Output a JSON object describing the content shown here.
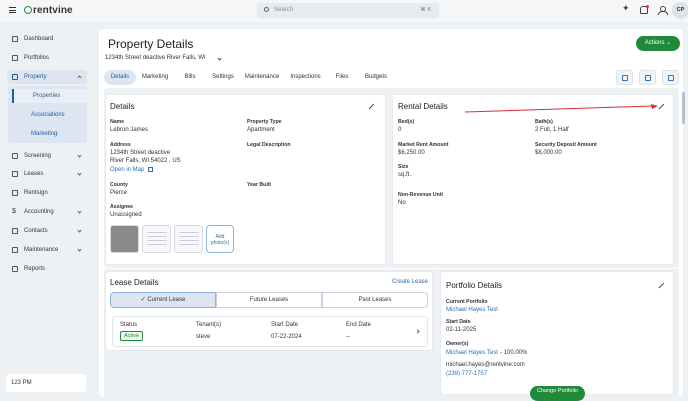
{
  "topbar": {
    "logo": "rentvine",
    "search_placeholder": "Search",
    "search_shortcut": "⌘ K",
    "avatar": "CP",
    "icons": [
      "menu-icon",
      "sparkle-icon",
      "bell-icon",
      "person-icon"
    ]
  },
  "sidebar": {
    "items": [
      {
        "label": "Dashboard",
        "icon": "dashboard-icon"
      },
      {
        "label": "Portfolios",
        "icon": "portfolio-icon"
      },
      {
        "label": "Property",
        "icon": "property-icon"
      },
      {
        "label": "Screening",
        "icon": "screening-icon"
      },
      {
        "label": "Leases",
        "icon": "lease-icon"
      },
      {
        "label": "Rentsign",
        "icon": "rentsign-icon"
      },
      {
        "label": "Accounting",
        "icon": "dollar-icon"
      },
      {
        "label": "Contacts",
        "icon": "contacts-icon"
      },
      {
        "label": "Maintenance",
        "icon": "maintenance-icon"
      },
      {
        "label": "Reports",
        "icon": "reports-icon"
      }
    ],
    "subitems": [
      "Properties",
      "Associations",
      "Marketing"
    ],
    "clock": "123 PM"
  },
  "page": {
    "title": "Property Details",
    "address_select": "1234th Street deactive River Falls, WI",
    "actions_label": "Actions",
    "tabs": [
      "Details",
      "Marketing",
      "Bills",
      "Settings",
      "Maintenance",
      "Inspections",
      "Files",
      "Budgets"
    ]
  },
  "details": {
    "title": "Details",
    "name_label": "Name",
    "name": "Lebron James",
    "property_type_label": "Property Type",
    "property_type": "Apartment",
    "address_label": "Address",
    "address_line1": "1234th Street deactive",
    "address_line2": "River Falls, WI 54022 , US",
    "legal_label": "Legal Description",
    "open_map": "Open in Map",
    "county_label": "County",
    "county": "Pierce",
    "year_label": "Year Built",
    "assignee_label": "Assignee",
    "assignee": "Unassigned",
    "add_photo": "Add photo(s)"
  },
  "rental": {
    "title": "Rental Details",
    "beds_label": "Bed(s)",
    "beds": "0",
    "baths_label": "Bath(s)",
    "baths": "2 Full, 1 Half",
    "market_label": "Market Rent Amount",
    "market": "$6,250.00",
    "deposit_label": "Security Deposit Amount",
    "deposit": "$8,000.00",
    "size_label": "Size",
    "size": "sq.ft.",
    "nonrev_label": "Non-Revenue Unit",
    "nonrev": "No"
  },
  "lease": {
    "title": "Lease Details",
    "create": "Create Lease",
    "segments": [
      "Current Lease",
      "Future Leases",
      "Past Leases"
    ],
    "headers": [
      "Status",
      "Tenant(s)",
      "Start Date",
      "End Date"
    ],
    "row": {
      "status": "Active",
      "tenant": "steve",
      "start": "07-22-2024",
      "end": "--"
    }
  },
  "portfolio": {
    "title": "Portfolio Details",
    "current_label": "Current Portfolio",
    "current": "Michael Hayes Test",
    "start_label": "Start Date",
    "start": "02-11-2025",
    "owners_label": "Owner(s)",
    "owner": "Michael Hayes Test",
    "owner_pct": " - 100.00%",
    "email": "michael.hayes@rentvine.com",
    "phone": "(239) 777-1757",
    "button_peek": "Change Portfolio"
  }
}
